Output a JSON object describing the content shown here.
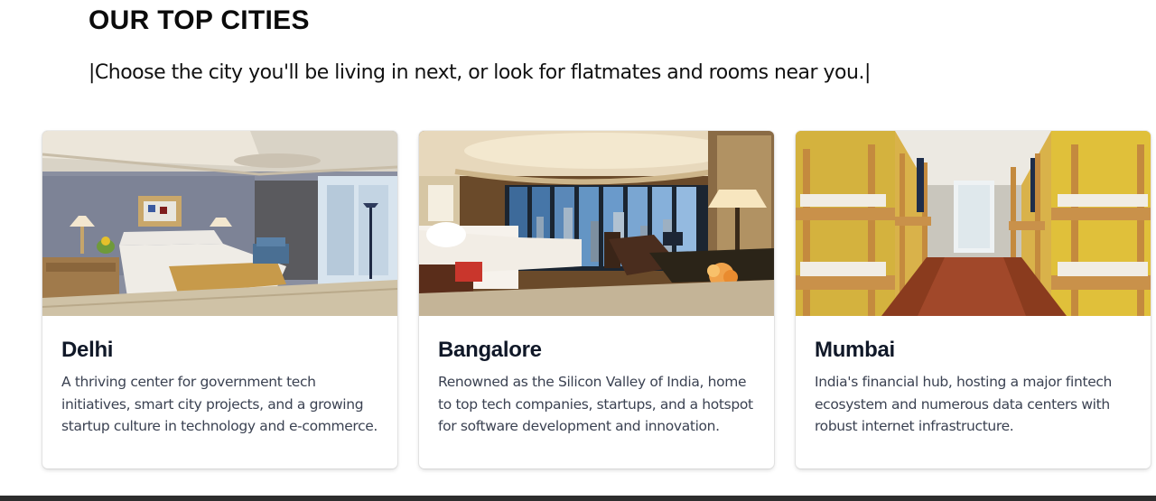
{
  "section": {
    "title": "OUR TOP CITIES",
    "subtitle": "|Choose the city you'll be living in next, or look for flatmates and rooms near you.|"
  },
  "cities": [
    {
      "name": "Delhi",
      "description": "A thriving center for government tech initiatives, smart city projects, and a growing startup culture in technology and e-commerce."
    },
    {
      "name": "Bangalore",
      "description": "Renowned as the Silicon Valley of India, home to top tech companies, startups, and a hotspot for software development and innovation."
    },
    {
      "name": "Mumbai",
      "description": "India's financial hub, hosting a major fintech ecosystem and numerous data centers with robust internet infrastructure."
    }
  ]
}
